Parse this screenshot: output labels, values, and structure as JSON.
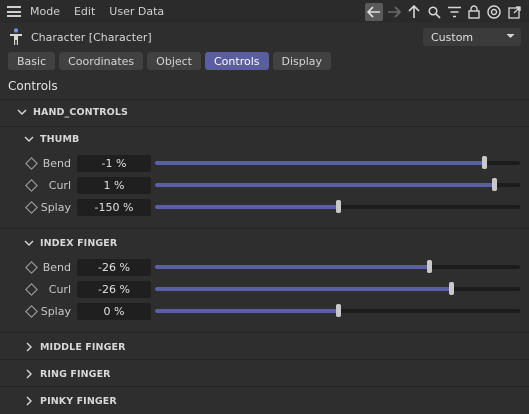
{
  "menu": {
    "items": [
      "Mode",
      "Edit",
      "User Data"
    ]
  },
  "nav_icons": [
    "back-arrow-icon",
    "forward-arrow-icon",
    "up-arrow-icon",
    "search-icon",
    "filter-icon",
    "lock-icon",
    "target-icon",
    "new-window-icon"
  ],
  "object": {
    "label": "Character [Character]",
    "preset": "Custom"
  },
  "tabs": [
    {
      "label": "Basic",
      "active": false
    },
    {
      "label": "Coordinates",
      "active": false
    },
    {
      "label": "Object",
      "active": false
    },
    {
      "label": "Controls",
      "active": true
    },
    {
      "label": "Display",
      "active": false
    }
  ],
  "section_title": "Controls",
  "hand_controls": {
    "label": "HAND_CONTROLS",
    "groups": [
      {
        "label": "THUMB",
        "expanded": true,
        "params": [
          {
            "label": "Bend",
            "value": "-1 %",
            "slider": 0.9
          },
          {
            "label": "Curl",
            "value": "1 %",
            "slider": 0.93
          },
          {
            "label": "Splay",
            "value": "-150 %",
            "slider": 0.5
          }
        ]
      },
      {
        "label": "INDEX FINGER",
        "expanded": true,
        "params": [
          {
            "label": "Bend",
            "value": "-26 %",
            "slider": 0.75
          },
          {
            "label": "Curl",
            "value": "-26 %",
            "slider": 0.81
          },
          {
            "label": "Splay",
            "value": "0 %",
            "slider": 0.5
          }
        ]
      },
      {
        "label": "MIDDLE FINGER",
        "expanded": false
      },
      {
        "label": "RING FINGER",
        "expanded": false
      },
      {
        "label": "PINKY FINGER",
        "expanded": false
      }
    ]
  },
  "colors": {
    "accent": "#5b5e9e",
    "slider_fill": "#5b5fa8",
    "background": "#2e2e2e"
  }
}
